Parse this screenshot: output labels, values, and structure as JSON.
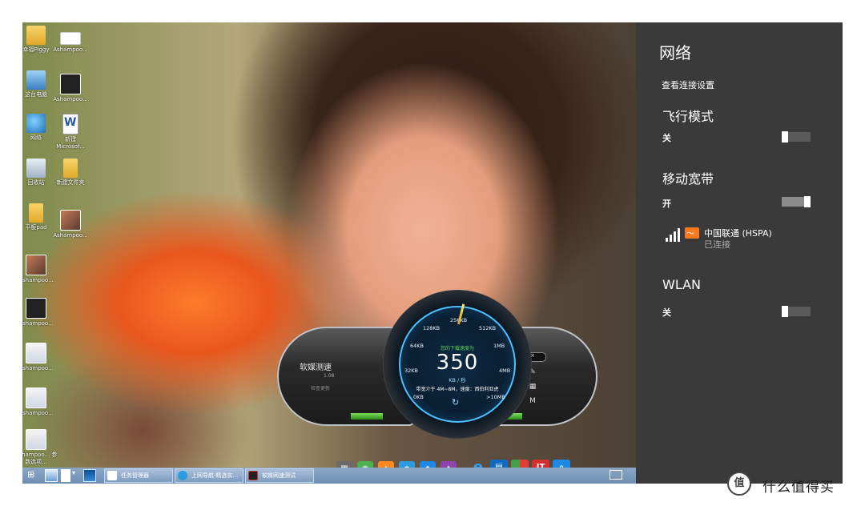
{
  "desktop_icons": [
    {
      "label": "幸福Piggy",
      "icon": "folder-icon"
    },
    {
      "label": "Ashampoo...",
      "icon": "screenshot-icon"
    },
    {
      "label": "这台电脑",
      "icon": "computer-icon"
    },
    {
      "label": "Ashampoo...",
      "icon": "screenshot-icon"
    },
    {
      "label": "网络",
      "icon": "network-icon"
    },
    {
      "label": "新建 Microsof...",
      "icon": "word-doc-icon"
    },
    {
      "label": "回收站",
      "icon": "recycle-bin-icon"
    },
    {
      "label": "新建文件夹",
      "icon": "folder-icon"
    },
    {
      "label": "平板pad",
      "icon": "folder-icon"
    },
    {
      "label": "Ashampoo...",
      "icon": "photo-icon"
    },
    {
      "label": "Ashampoo...",
      "icon": "photo-icon"
    },
    {
      "label": "Ashampoo...",
      "icon": "screenshot-icon"
    },
    {
      "label": "Ashampoo...",
      "icon": "screenshot-icon"
    },
    {
      "label": "Ashampoo...",
      "icon": "screenshot-icon"
    },
    {
      "label": "Ashampoo... 参数选项...",
      "icon": "screenshot-icon"
    }
  ],
  "network_pane": {
    "title": "网络",
    "settings_link": "查看连接设置",
    "airplane": {
      "heading": "飞行模式",
      "state": "关",
      "on": false
    },
    "mobile": {
      "heading": "移动宽带",
      "state": "开",
      "on": true
    },
    "connection": {
      "name": "中国联通 (HSPA)",
      "status": "已连接"
    },
    "wlan": {
      "heading": "WLAN",
      "state": "关",
      "on": false
    }
  },
  "speed_widget": {
    "app_name": "软媒测速",
    "version": "1.08",
    "update_label": "检查更新",
    "caption": "您的下载速度为",
    "value": "350",
    "unit": "KB / 秒",
    "info": "带宽介于 4M~8M，速度：西伯利亚虎",
    "ticks": [
      "0KB",
      "32KB",
      "64KB",
      "128KB",
      "256KB",
      "512KB",
      "1MB",
      "4MB",
      ">10MB"
    ],
    "refresh_icon": "refresh-icon"
  },
  "dock_icons": [
    "apps-icon",
    "game-icon",
    "shop-icon",
    "ie-icon",
    "app-icon",
    "tools-icon",
    "ie-icon",
    "office-icon",
    "chrome-icon",
    "ithome-icon",
    "search-icon"
  ],
  "dock_ithome": "IT",
  "taskbar": {
    "buttons": [
      {
        "label": "任务管理器"
      },
      {
        "label": "上网导航-精选实..."
      },
      {
        "label": "软媒网速测试"
      }
    ]
  },
  "watermark": {
    "logo": "值",
    "text": "什么值得买"
  }
}
